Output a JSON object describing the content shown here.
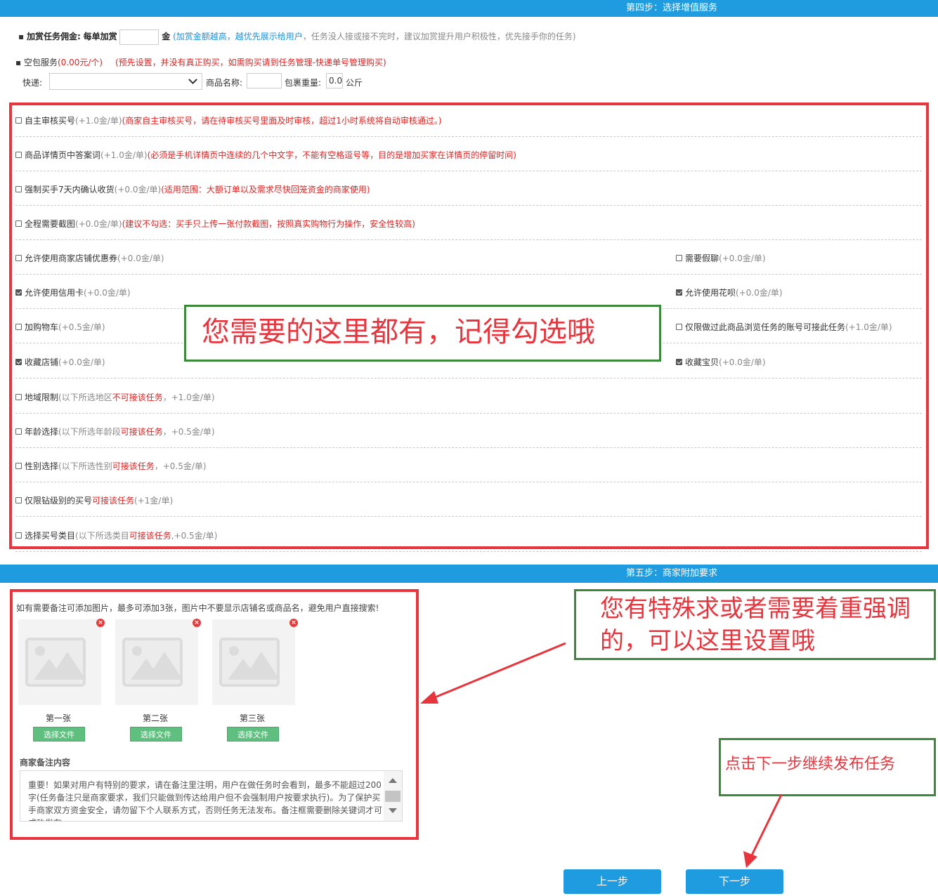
{
  "step4": {
    "title": "第四步：选择增值服务"
  },
  "bounty": {
    "label": "加赏任务佣金:",
    "per_label": "每单加赏",
    "value": "",
    "unit": "金",
    "hint_blue": "(加赏金额越高，越优先展示给用户",
    "hint_grey": "，任务没人接或接不完时，建议加赏提升用户积极性，优先接手你的任务)"
  },
  "empty_pack": {
    "label": "空包服务",
    "price": "(0.00元/个)",
    "hint": "(预先设置，并没有真正购买，如需购买请到任务管理-快递单号管理购买)",
    "express_label": "快递:",
    "express_value": "",
    "product_label": "商品名称:",
    "product_value": "",
    "weight_label": "包裹重量:",
    "weight_value": "0.0",
    "weight_unit": "公斤"
  },
  "options": [
    {
      "label": "自主审核买号",
      "price": "(+1.0金/单)",
      "note": " (商家自主审核买号，请在待审核买号里面及时审核，超过1小时系统将自动审核通过。)",
      "checked": false
    },
    {
      "label": "商品详情页中答案词",
      "price": "  (+1.0金/单)",
      "note": "  (必须是手机详情页中连续的几个中文字，不能有空格逗号等，目的是增加买家在详情页的停留时间)",
      "checked": false
    },
    {
      "label": "强制买手7天内确认收货",
      "price": "  (+0.0金/单)",
      "note": "   (适用范围：大额订单以及需求尽快回笼资金的商家使用)",
      "checked": false
    },
    {
      "label": "全程需要截图",
      "price": "  (+0.0金/单)",
      "note": "   (建议不勾选：买手只上传一张付款截图，按照真实购物行为操作，安全性较高)",
      "checked": false
    },
    {
      "label": "允许使用商家店铺优惠券",
      "price": "  (+0.0金/单)",
      "checked": false
    },
    {
      "label": "需要假聊",
      "price": "  (+0.0金/单)",
      "checked": false
    },
    {
      "label": "允许使用信用卡",
      "price": "  (+0.0金/单)",
      "checked": true
    },
    {
      "label": "允许使用花呗",
      "price": "  (+0.0金/单)",
      "checked": true
    },
    {
      "label": "加购物车",
      "price": "  (+0.5金/单)",
      "checked": false
    },
    {
      "label": "仅限做过此商品浏览任务的账号可接此任务",
      "price": "  (+1.0金/单)",
      "checked": false
    },
    {
      "label": "收藏店铺",
      "price": "  (+0.0金/单)",
      "checked": true
    },
    {
      "label": "收藏宝贝",
      "price": "  (+0.0金/单)",
      "checked": true
    },
    {
      "label": "地域限制",
      "pre": " (以下所选地区",
      "red": "不可接该任务",
      "post": "，+1.0金/单)",
      "checked": false
    },
    {
      "label": "年龄选择",
      "pre": "  (以下所选年龄段",
      "red": "可接该任务",
      "post": "，+0.5金/单)",
      "checked": false
    },
    {
      "label": "性别选择",
      "pre": "  (以下所选性别",
      "red": "可接该任务",
      "post": "，+0.5金/单)",
      "checked": false
    },
    {
      "label": "仅限钻级别的买号",
      "red": "可接该任务",
      "post": "  (+1金/单)",
      "checked": false
    },
    {
      "label": "选择买号类目",
      "pre": " (以下所选类目",
      "red": "可接该任务",
      "post": " ,+0.5金/单)",
      "checked": false
    }
  ],
  "annotations": {
    "a1": "您需要的这里都有，记得勾选哦",
    "a2_line1": "您有特殊求或者需要着重强调",
    "a2_line2": "的，可以这里设置哦",
    "a3": "点击下一步继续发布任务"
  },
  "step5": {
    "title": "第五步：商家附加要求",
    "hint": "如有需要备注可添加图片，最多可添加3张，图片中不要显示店铺名或商品名，避免用户直接搜索!",
    "images": [
      {
        "label": "第一张",
        "button": "选择文件"
      },
      {
        "label": "第二张",
        "button": "选择文件"
      },
      {
        "label": "第三张",
        "button": "选择文件"
      }
    ],
    "remark_label": "商家备注内容",
    "remark_text": "重要！如果对用户有特别的要求，请在备注里注明，用户在做任务时会看到，最多不能超过200字(任务备注只是商家要求，我们只能做到传达给用户但不会强制用户按要求执行)。为了保护买手商家双方资金安全，请勿留下个人联系方式，否则任务无法发布。备注框需要删除关键词才可成功发布"
  },
  "nav": {
    "prev": "上一步",
    "next": "下一步"
  },
  "colors": {
    "step_bar": "#1f9be0",
    "highlight_red": "#e8343c",
    "annotation_green": "#3a8a3a",
    "file_button": "#5fbf7f"
  }
}
